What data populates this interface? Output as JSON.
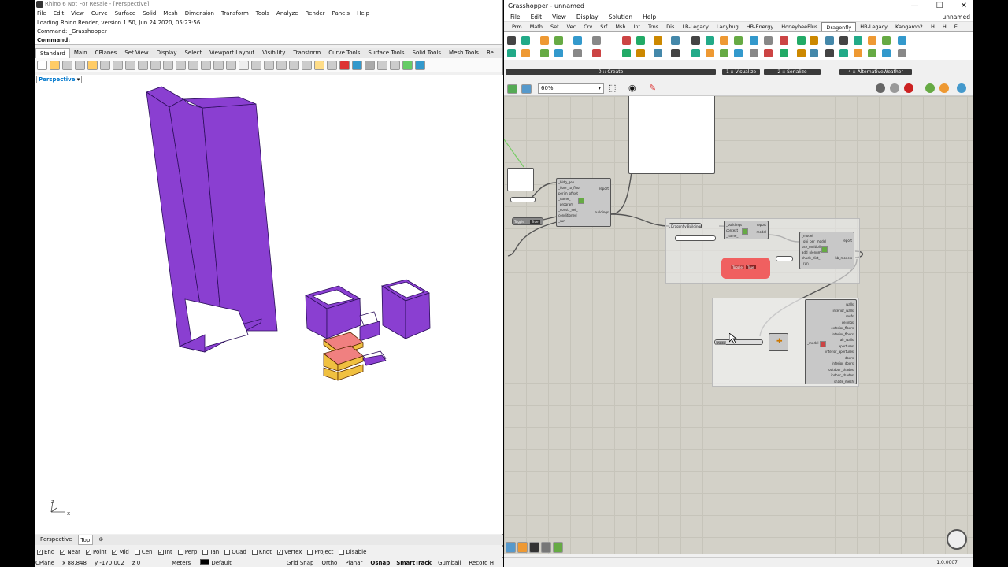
{
  "rhino": {
    "title": "Rhino 6 Not For Resale - [Perspective]",
    "menu": [
      "File",
      "Edit",
      "View",
      "Curve",
      "Surface",
      "Solid",
      "Mesh",
      "Dimension",
      "Transform",
      "Tools",
      "Analyze",
      "Render",
      "Panels",
      "Help"
    ],
    "command_history": "Loading Rhino Render, version 1.50, Jun 24 2020, 05:23:56",
    "command_prev": "Command: _Grasshopper",
    "command_prompt": "Command:",
    "toolbar_tabs": [
      "Standard",
      "Main",
      "CPlanes",
      "Set View",
      "Display",
      "Select",
      "Viewport Layout",
      "Visibility",
      "Transform",
      "Curve Tools",
      "Surface Tools",
      "Solid Tools",
      "Mesh Tools",
      "Re"
    ],
    "active_tab": "Standard",
    "viewport_label": "Perspective",
    "axis_x": "x",
    "axis_z": "z",
    "viewport_tabs": [
      "Perspective",
      "Top"
    ],
    "viewport_add": "⊕",
    "osnaps": [
      {
        "label": "End",
        "checked": true
      },
      {
        "label": "Near",
        "checked": true
      },
      {
        "label": "Point",
        "checked": true
      },
      {
        "label": "Mid",
        "checked": true
      },
      {
        "label": "Cen",
        "checked": false
      },
      {
        "label": "Int",
        "checked": true
      },
      {
        "label": "Perp",
        "checked": false
      },
      {
        "label": "Tan",
        "checked": false
      },
      {
        "label": "Quad",
        "checked": false
      },
      {
        "label": "Knot",
        "checked": false
      },
      {
        "label": "Vertex",
        "checked": true
      },
      {
        "label": "Project",
        "checked": false
      },
      {
        "label": "Disable",
        "checked": false
      }
    ],
    "status": {
      "cplane": "CPlane",
      "x": "x 88.848",
      "y": "y -170.002",
      "z": "z 0",
      "units": "Meters",
      "layer": "Default",
      "grid_snap": "Grid Snap",
      "ortho": "Ortho",
      "planar": "Planar",
      "osnap": "Osnap",
      "smarttrack": "SmartTrack",
      "gumball": "Gumball",
      "record": "Record H"
    },
    "colors": {
      "building": "#8a3fd1",
      "highlight_red": "#f08080",
      "highlight_yellow": "#f0c040"
    }
  },
  "gh": {
    "title": "Grasshopper - unnamed",
    "window_buttons": [
      "—",
      "☐",
      "✕"
    ],
    "menu": [
      "File",
      "Edit",
      "View",
      "Display",
      "Solution",
      "Help"
    ],
    "doc_name": "unnamed",
    "tabs": [
      "Prm",
      "Math",
      "Set",
      "Vec",
      "Crv",
      "Srf",
      "Msh",
      "Int",
      "Trns",
      "Dis",
      "LB-Legacy",
      "Ladybug",
      "HB-Energy",
      "HoneybeePlus",
      "Dragonfly",
      "HB-Legacy",
      "Kangaroo2",
      "H",
      "H",
      "E"
    ],
    "active_tab": "Dragonfly",
    "groups": [
      "0 :: Create",
      "1 :: Visualize",
      "2 :: Serialize",
      "4 :: AlternativeWeather"
    ],
    "zoom": "60%",
    "components": {
      "bldg": {
        "title": "_bldg_geo",
        "inputs": [
          "_bldg_geo",
          "_floor_to_floor",
          "perim_offset_",
          "_name_",
          "_program_",
          "_constr_set_",
          "conditioned_",
          "_run"
        ],
        "outputs": [
          "report",
          "buildings"
        ]
      },
      "model": {
        "title": "_buildings",
        "inputs": [
          "_buildings",
          "context_",
          "_name_"
        ],
        "outputs": [
          "report",
          "model"
        ]
      },
      "tohb": {
        "inputs": [
          "_model",
          "_obj_per_model_",
          "use_multiplier_",
          "add_plenum_",
          "shade_dist_",
          "_run"
        ],
        "outputs": [
          "report",
          "hb_models"
        ]
      },
      "panel_label": "Dragonfly Buildings",
      "toggle1": {
        "label": "Toggle",
        "value": "True"
      },
      "toggle2": {
        "label": "Toggle",
        "value": "True"
      },
      "index_label": "Index",
      "deconstruct_outputs": [
        "walls",
        "interior_walls",
        "roofs",
        "ceilings",
        "exterior_floors",
        "interior_floors",
        "air_walls",
        "apertures",
        "interior_apertures",
        "doors",
        "interior_doors",
        "outdoor_shades",
        "indoor_shades",
        "shade_mesh"
      ],
      "deconstruct_input": "_model"
    },
    "version": "1.0.0007",
    "colors": {
      "canvas": "#d3d1c8",
      "toggle_selected": "#f06060"
    }
  }
}
